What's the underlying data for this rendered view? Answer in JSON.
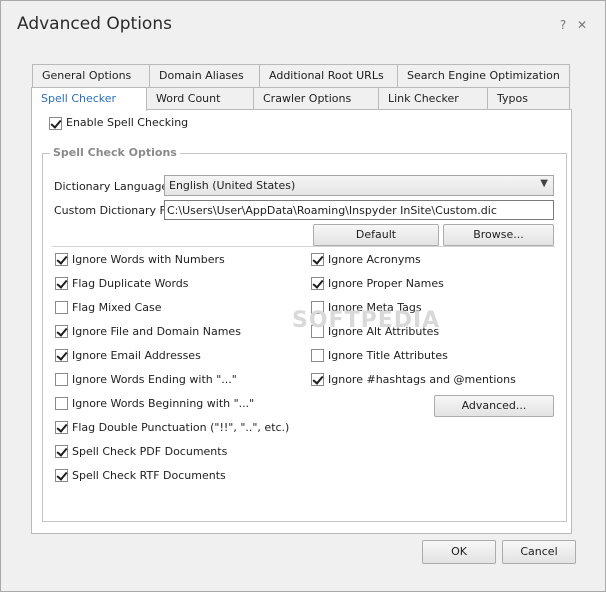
{
  "window": {
    "title": "Advanced Options",
    "help_glyph": "?",
    "close_glyph": "✕"
  },
  "tabs_row1": [
    {
      "label": "General Options"
    },
    {
      "label": "Domain Aliases"
    },
    {
      "label": "Additional Root URLs"
    },
    {
      "label": "Search Engine Optimization"
    }
  ],
  "tabs_row2": [
    {
      "label": "Spell Checker",
      "active": true
    },
    {
      "label": "Word Count"
    },
    {
      "label": "Crawler Options"
    },
    {
      "label": "Link Checker"
    },
    {
      "label": "Typos"
    }
  ],
  "enable": {
    "label": "Enable Spell Checking",
    "checked": true
  },
  "group": {
    "title": "Spell Check Options"
  },
  "dictionary": {
    "label": "Dictionary Language",
    "value": "English (United States)",
    "custom_label": "Custom Dictionary File",
    "custom_value": "C:\\Users\\User\\AppData\\Roaming\\Inspyder InSite\\Custom.dic",
    "default_button": "Default",
    "browse_button": "Browse..."
  },
  "left_options": [
    {
      "label": "Ignore Words with Numbers",
      "checked": true
    },
    {
      "label": "Flag Duplicate Words",
      "checked": true
    },
    {
      "label": "Flag Mixed Case",
      "checked": false
    },
    {
      "label": "Ignore File and Domain Names",
      "checked": true
    },
    {
      "label": "Ignore Email Addresses",
      "checked": true
    },
    {
      "label": "Ignore Words Ending with \"...\"",
      "checked": false
    },
    {
      "label": "Ignore Words Beginning with \"...\"",
      "checked": false
    },
    {
      "label": "Flag Double Punctuation (\"!!\", \"..\", etc.)",
      "checked": true
    },
    {
      "label": "Spell Check PDF Documents",
      "checked": true
    },
    {
      "label": "Spell Check RTF Documents",
      "checked": true
    }
  ],
  "right_options": [
    {
      "label": "Ignore Acronyms",
      "checked": true
    },
    {
      "label": "Ignore Proper Names",
      "checked": true
    },
    {
      "label": "Ignore Meta Tags",
      "checked": false
    },
    {
      "label": "Ignore Alt Attributes",
      "checked": false
    },
    {
      "label": "Ignore Title Attributes",
      "checked": false
    },
    {
      "label": "Ignore #hashtags and @mentions",
      "checked": true
    }
  ],
  "advanced_button": "Advanced...",
  "footer": {
    "ok": "OK",
    "cancel": "Cancel"
  }
}
